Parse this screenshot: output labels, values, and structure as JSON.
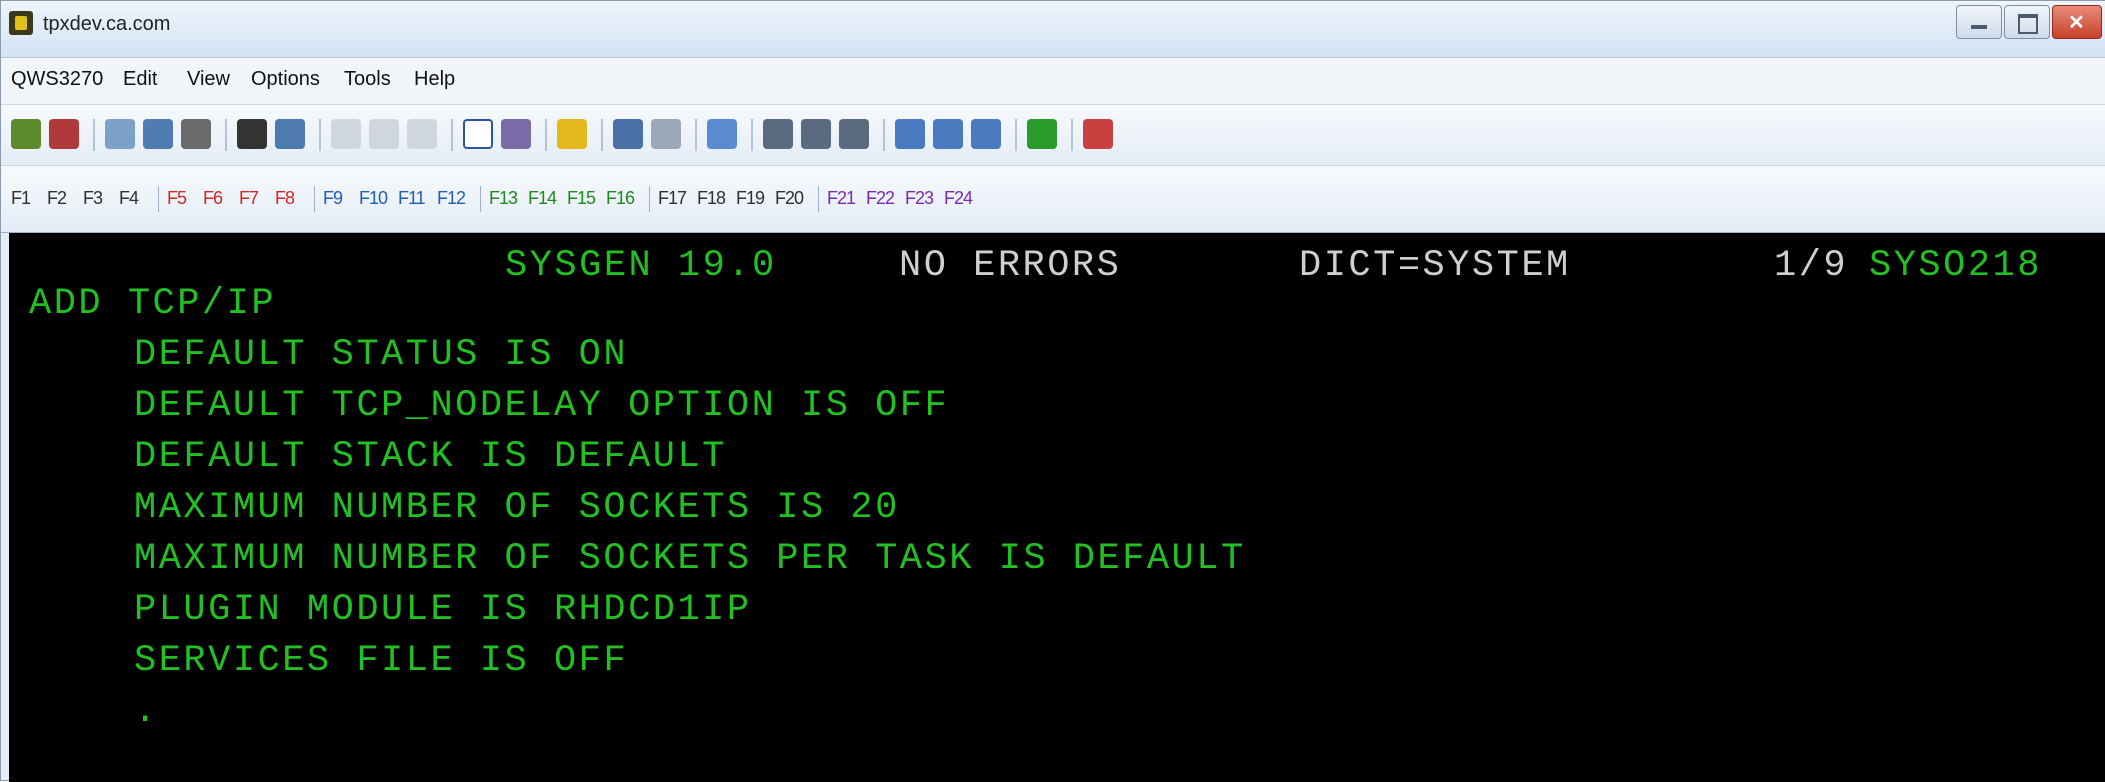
{
  "window": {
    "title": "tpxdev.ca.com"
  },
  "menu": [
    "QWS3270",
    "Edit",
    "View",
    "Options",
    "Tools",
    "Help"
  ],
  "fkeys": [
    "F1",
    "F2",
    "F3",
    "F4",
    "F5",
    "F6",
    "F7",
    "F8",
    "F9",
    "F10",
    "F11",
    "F12",
    "F13",
    "F14",
    "F15",
    "F16",
    "F17",
    "F18",
    "F19",
    "F20",
    "F21",
    "F22",
    "F23",
    "F24"
  ],
  "fkey_colors": [
    "#303030",
    "#d02828",
    "#1f5fb0",
    "#1c8a1c",
    "#1c8a1c",
    "#7a2ab0"
  ],
  "terminal": {
    "header": {
      "product": "SYSGEN 19.0",
      "status": "NO ERRORS",
      "dict": "DICT=SYSTEM",
      "page": "1/9",
      "screen_id": "SYSO218"
    },
    "lines": [
      "ADD TCP/IP",
      "DEFAULT STATUS IS ON",
      "DEFAULT TCP_NODELAY OPTION IS OFF",
      "DEFAULT STACK IS DEFAULT",
      "MAXIMUM NUMBER OF SOCKETS IS 20",
      "MAXIMUM NUMBER OF SOCKETS PER TASK IS DEFAULT",
      "PLUGIN MODULE IS RHDCD1IP",
      "SERVICES FILE IS OFF",
      "."
    ],
    "colors": {
      "background": "#000000",
      "text": "#22c022",
      "secondary": "#cfcfcf"
    }
  }
}
